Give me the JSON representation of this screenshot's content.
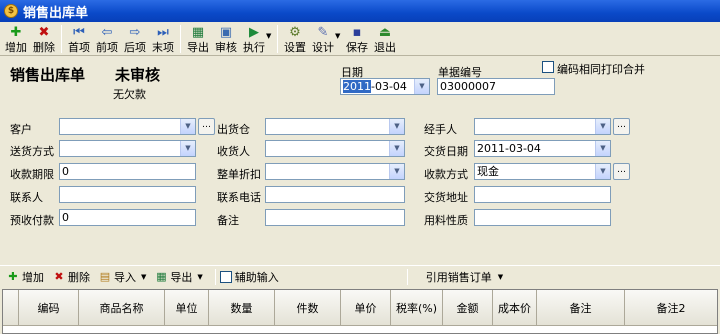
{
  "window": {
    "title": "销售出库单"
  },
  "toolbar": {
    "add": "增加",
    "delete": "删除",
    "first": "首项",
    "prev": "前项",
    "next": "后项",
    "last": "末项",
    "export": "导出",
    "audit": "审核",
    "execute": "执行",
    "settings": "设置",
    "design": "设计",
    "save": "保存",
    "exit": "退出"
  },
  "doc": {
    "title": "销售出库单",
    "status": "未审核",
    "payment_status": "无欠款",
    "date_label": "日期",
    "date_value_year": "2011",
    "date_value_rest": "-03-04",
    "docno_label": "单据编号",
    "docno_value": "03000007",
    "merge_print_label": "编码相同打印合并"
  },
  "form": {
    "customer": {
      "label": "客户",
      "value": ""
    },
    "warehouse": {
      "label": "出货仓",
      "value": ""
    },
    "handler": {
      "label": "经手人",
      "value": ""
    },
    "shipping_method": {
      "label": "送货方式",
      "value": ""
    },
    "receiver": {
      "label": "收货人",
      "value": ""
    },
    "delivery_date": {
      "label": "交货日期",
      "value": "2011-03-04"
    },
    "payment_term": {
      "label": "收款期限",
      "value": "0"
    },
    "discount": {
      "label": "整单折扣",
      "value": ""
    },
    "payment_method": {
      "label": "收款方式",
      "value": "现金"
    },
    "contact": {
      "label": "联系人",
      "value": ""
    },
    "phone": {
      "label": "联系电话",
      "value": ""
    },
    "delivery_address": {
      "label": "交货地址",
      "value": ""
    },
    "prepaid": {
      "label": "预收付款",
      "value": "0"
    },
    "remark": {
      "label": "备注",
      "value": ""
    },
    "material_nature": {
      "label": "用料性质",
      "value": ""
    }
  },
  "detail_toolbar": {
    "add": "增加",
    "delete": "删除",
    "import": "导入",
    "export": "导出",
    "assist_input": "辅助输入",
    "ref_order": "引用销售订单"
  },
  "grid": {
    "columns": [
      "",
      "编码",
      "商品名称",
      "单位",
      "数量",
      "件数",
      "单价",
      "税率(%)",
      "金额",
      "成本价",
      "备注",
      "备注2"
    ]
  },
  "colors": {
    "titlebar": "#0a49c9",
    "face": "#ece9d8",
    "field_border": "#7f9db9",
    "selection": "#316ac5"
  }
}
